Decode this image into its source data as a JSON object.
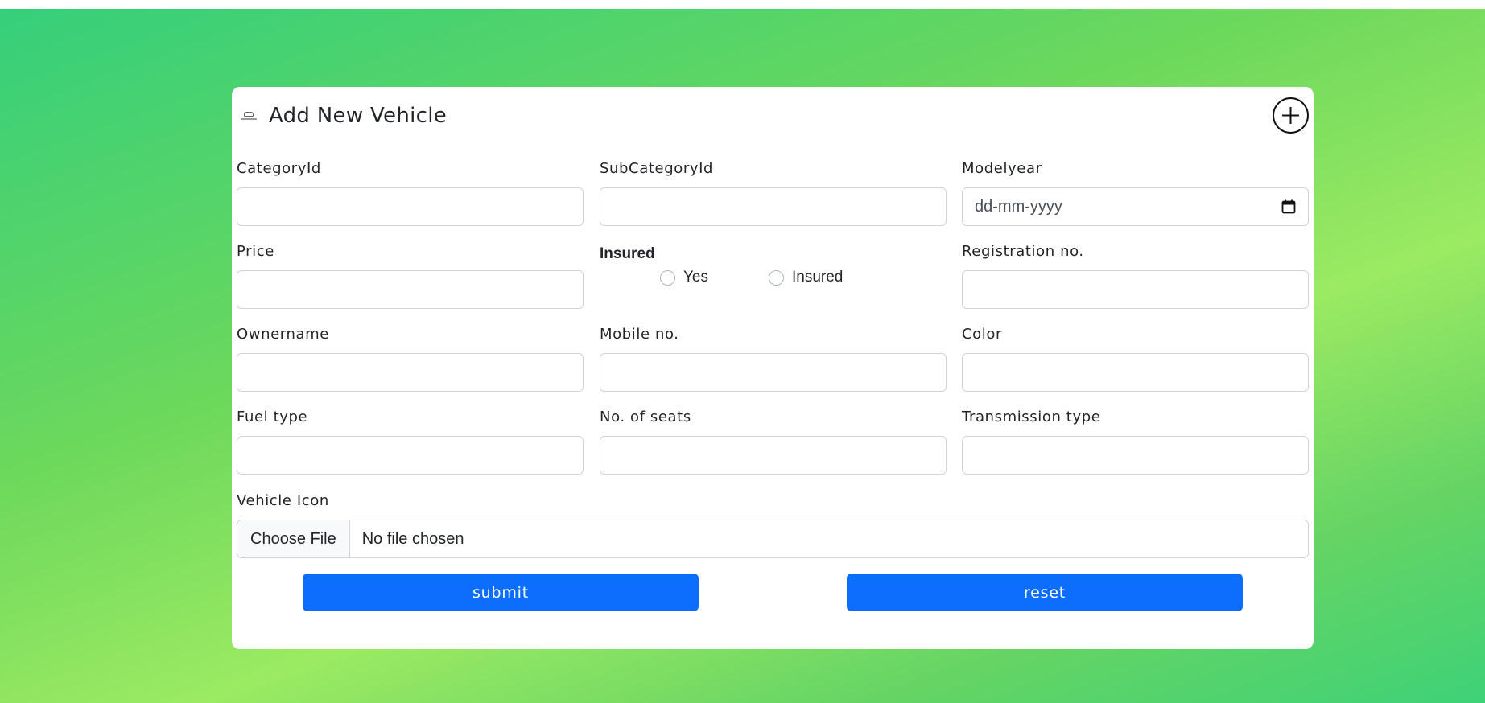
{
  "form": {
    "title": "Add New Vehicle",
    "add_icon": "plus-circle-icon",
    "logo_icon": "vehicle-logo-icon",
    "fields": {
      "category": {
        "label": "CategoryId",
        "value": ""
      },
      "subcategory": {
        "label": "SubCategoryId",
        "value": ""
      },
      "modelyear": {
        "label": "Modelyear",
        "placeholder": "dd-mm-yyyy",
        "icon": "calendar-icon"
      },
      "price": {
        "label": "Price",
        "value": ""
      },
      "insured": {
        "label": "Insured",
        "options": [
          "Yes",
          "Insured"
        ]
      },
      "registration": {
        "label": "Registration no.",
        "value": ""
      },
      "ownername": {
        "label": "Ownername",
        "value": ""
      },
      "mobile": {
        "label": "Mobile no.",
        "value": ""
      },
      "color": {
        "label": "Color",
        "value": ""
      },
      "fueltype": {
        "label": "Fuel type",
        "value": ""
      },
      "seats": {
        "label": "No. of seats",
        "value": ""
      },
      "transmission": {
        "label": "Transmission type",
        "value": ""
      },
      "vehicle_icon": {
        "label": "Vehicle Icon",
        "button": "Choose File",
        "status": "No file chosen"
      }
    },
    "buttons": {
      "submit": "submit",
      "reset": "reset"
    }
  },
  "colors": {
    "primary": "#0d6efd",
    "gradient_start": "#35cf7b",
    "gradient_mid": "#9bea62",
    "gradient_end": "#3ed277"
  }
}
